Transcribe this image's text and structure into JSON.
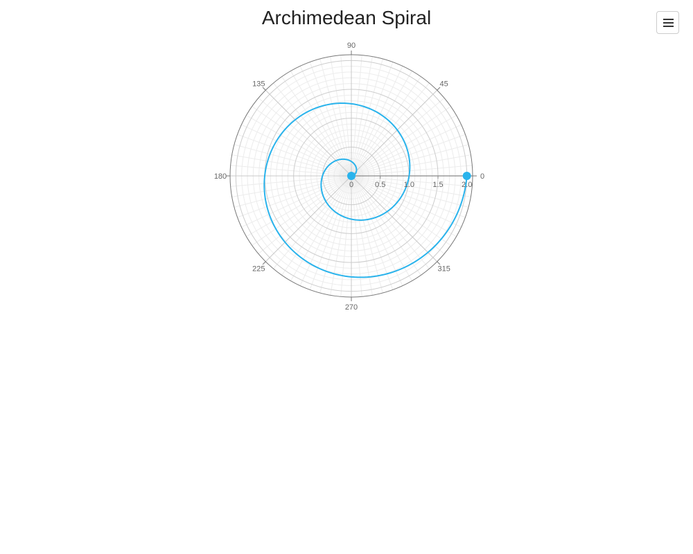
{
  "chart_data": {
    "type": "polar-line",
    "title": "Archimedean Spiral",
    "angle_axis": {
      "unit": "degrees",
      "direction": "counterclockwise",
      "zero_at": "right",
      "labels": [
        "0",
        "45",
        "90",
        "135",
        "180",
        "225",
        "270",
        "315"
      ],
      "label_angles": [
        0,
        45,
        90,
        135,
        180,
        225,
        270,
        315
      ]
    },
    "radial_axis": {
      "range": [
        0,
        2.1
      ],
      "tick_values": [
        0,
        0.5,
        1.0,
        1.5,
        2.0
      ],
      "tick_labels": [
        "0",
        "0.5",
        "1.0",
        "1.5",
        "2.0"
      ]
    },
    "grid": true,
    "series": [
      {
        "color": "#29b3ec",
        "theta_start_deg": 0,
        "theta_end_deg": 720,
        "r_start": 0,
        "r_end": 2.0,
        "points": [
          {
            "theta": 0,
            "r": 0
          },
          {
            "theta": 90,
            "r": 0.25
          },
          {
            "theta": 180,
            "r": 0.5
          },
          {
            "theta": 270,
            "r": 0.75
          },
          {
            "theta": 360,
            "r": 1.0
          },
          {
            "theta": 450,
            "r": 1.25
          },
          {
            "theta": 540,
            "r": 1.5
          },
          {
            "theta": 630,
            "r": 1.75
          },
          {
            "theta": 720,
            "r": 2.0
          }
        ],
        "markers": [
          {
            "theta": 0,
            "r": 0
          },
          {
            "theta": 720,
            "r": 2.0
          }
        ]
      }
    ]
  },
  "toolbar": {
    "menu_icon": "hamburger-menu-icon"
  }
}
